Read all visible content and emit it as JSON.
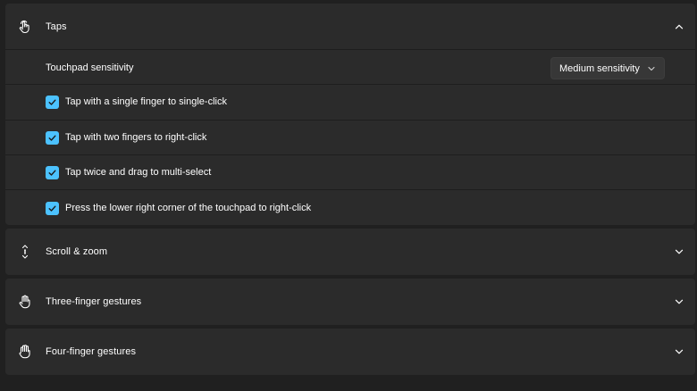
{
  "taps": {
    "title": "Taps",
    "icon": "tap-icon",
    "expanded": true,
    "sensitivity": {
      "label": "Touchpad sensitivity",
      "selected": "Medium sensitivity"
    },
    "options": [
      {
        "label": "Tap with a single finger to single-click",
        "checked": true
      },
      {
        "label": "Tap with two fingers to right-click",
        "checked": true
      },
      {
        "label": "Tap twice and drag to multi-select",
        "checked": true
      },
      {
        "label": "Press the lower right corner of the touchpad to right-click",
        "checked": true
      }
    ]
  },
  "sections": [
    {
      "title": "Scroll & zoom",
      "icon": "scroll-icon",
      "expanded": false
    },
    {
      "title": "Three-finger gestures",
      "icon": "three-finger-hand-icon",
      "expanded": false
    },
    {
      "title": "Four-finger gestures",
      "icon": "four-finger-hand-icon",
      "expanded": false
    }
  ],
  "colors": {
    "background": "#202020",
    "card": "#2b2b2b",
    "accent": "#4cc2ff"
  }
}
